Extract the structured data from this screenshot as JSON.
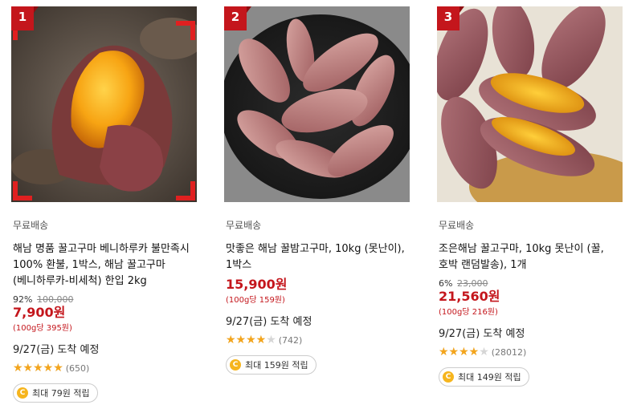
{
  "colors": {
    "accent": "#c4161c",
    "star": "#f4a51c",
    "coin": "#f6b51e"
  },
  "products": [
    {
      "rank": "1",
      "image_icon": "sweet-potato-roasted-icon",
      "shipping": "무료배송",
      "title": "해남 명품 꿀고구마 베니하루카 불만족시 100% 환불, 1박스, 해남 꿀고구마(베니하루카-비세척) 한입 2kg",
      "discount": "92%",
      "original_price": "100,000",
      "price": "7,900원",
      "unit_price": "(100g당 395원)",
      "arrival": "9/27(금) 도착 예정",
      "rating": 5,
      "review_count": "(650)",
      "reward": "최대 79원 적립"
    },
    {
      "rank": "2",
      "image_icon": "sweet-potato-raw-icon",
      "shipping": "무료배송",
      "title": "맛좋은 해남 꿀밤고구마, 10kg (못난이), 1박스",
      "discount": "",
      "original_price": "",
      "price": "15,900원",
      "unit_price": "(100g당 159원)",
      "arrival": "9/27(금) 도착 예정",
      "rating": 4,
      "review_count": "(742)",
      "reward": "최대 159원 적립"
    },
    {
      "rank": "3",
      "image_icon": "sweet-potato-basket-icon",
      "shipping": "무료배송",
      "title": "조은해남 꿀고구마, 10kg 못난이 (꿀, 호박 랜덤발송), 1개",
      "discount": "6%",
      "original_price": "23,000",
      "price": "21,560원",
      "unit_price": "(100g당 216원)",
      "arrival": "9/27(금) 도착 예정",
      "rating": 4,
      "review_count": "(28012)",
      "reward": "최대 149원 적립"
    }
  ]
}
